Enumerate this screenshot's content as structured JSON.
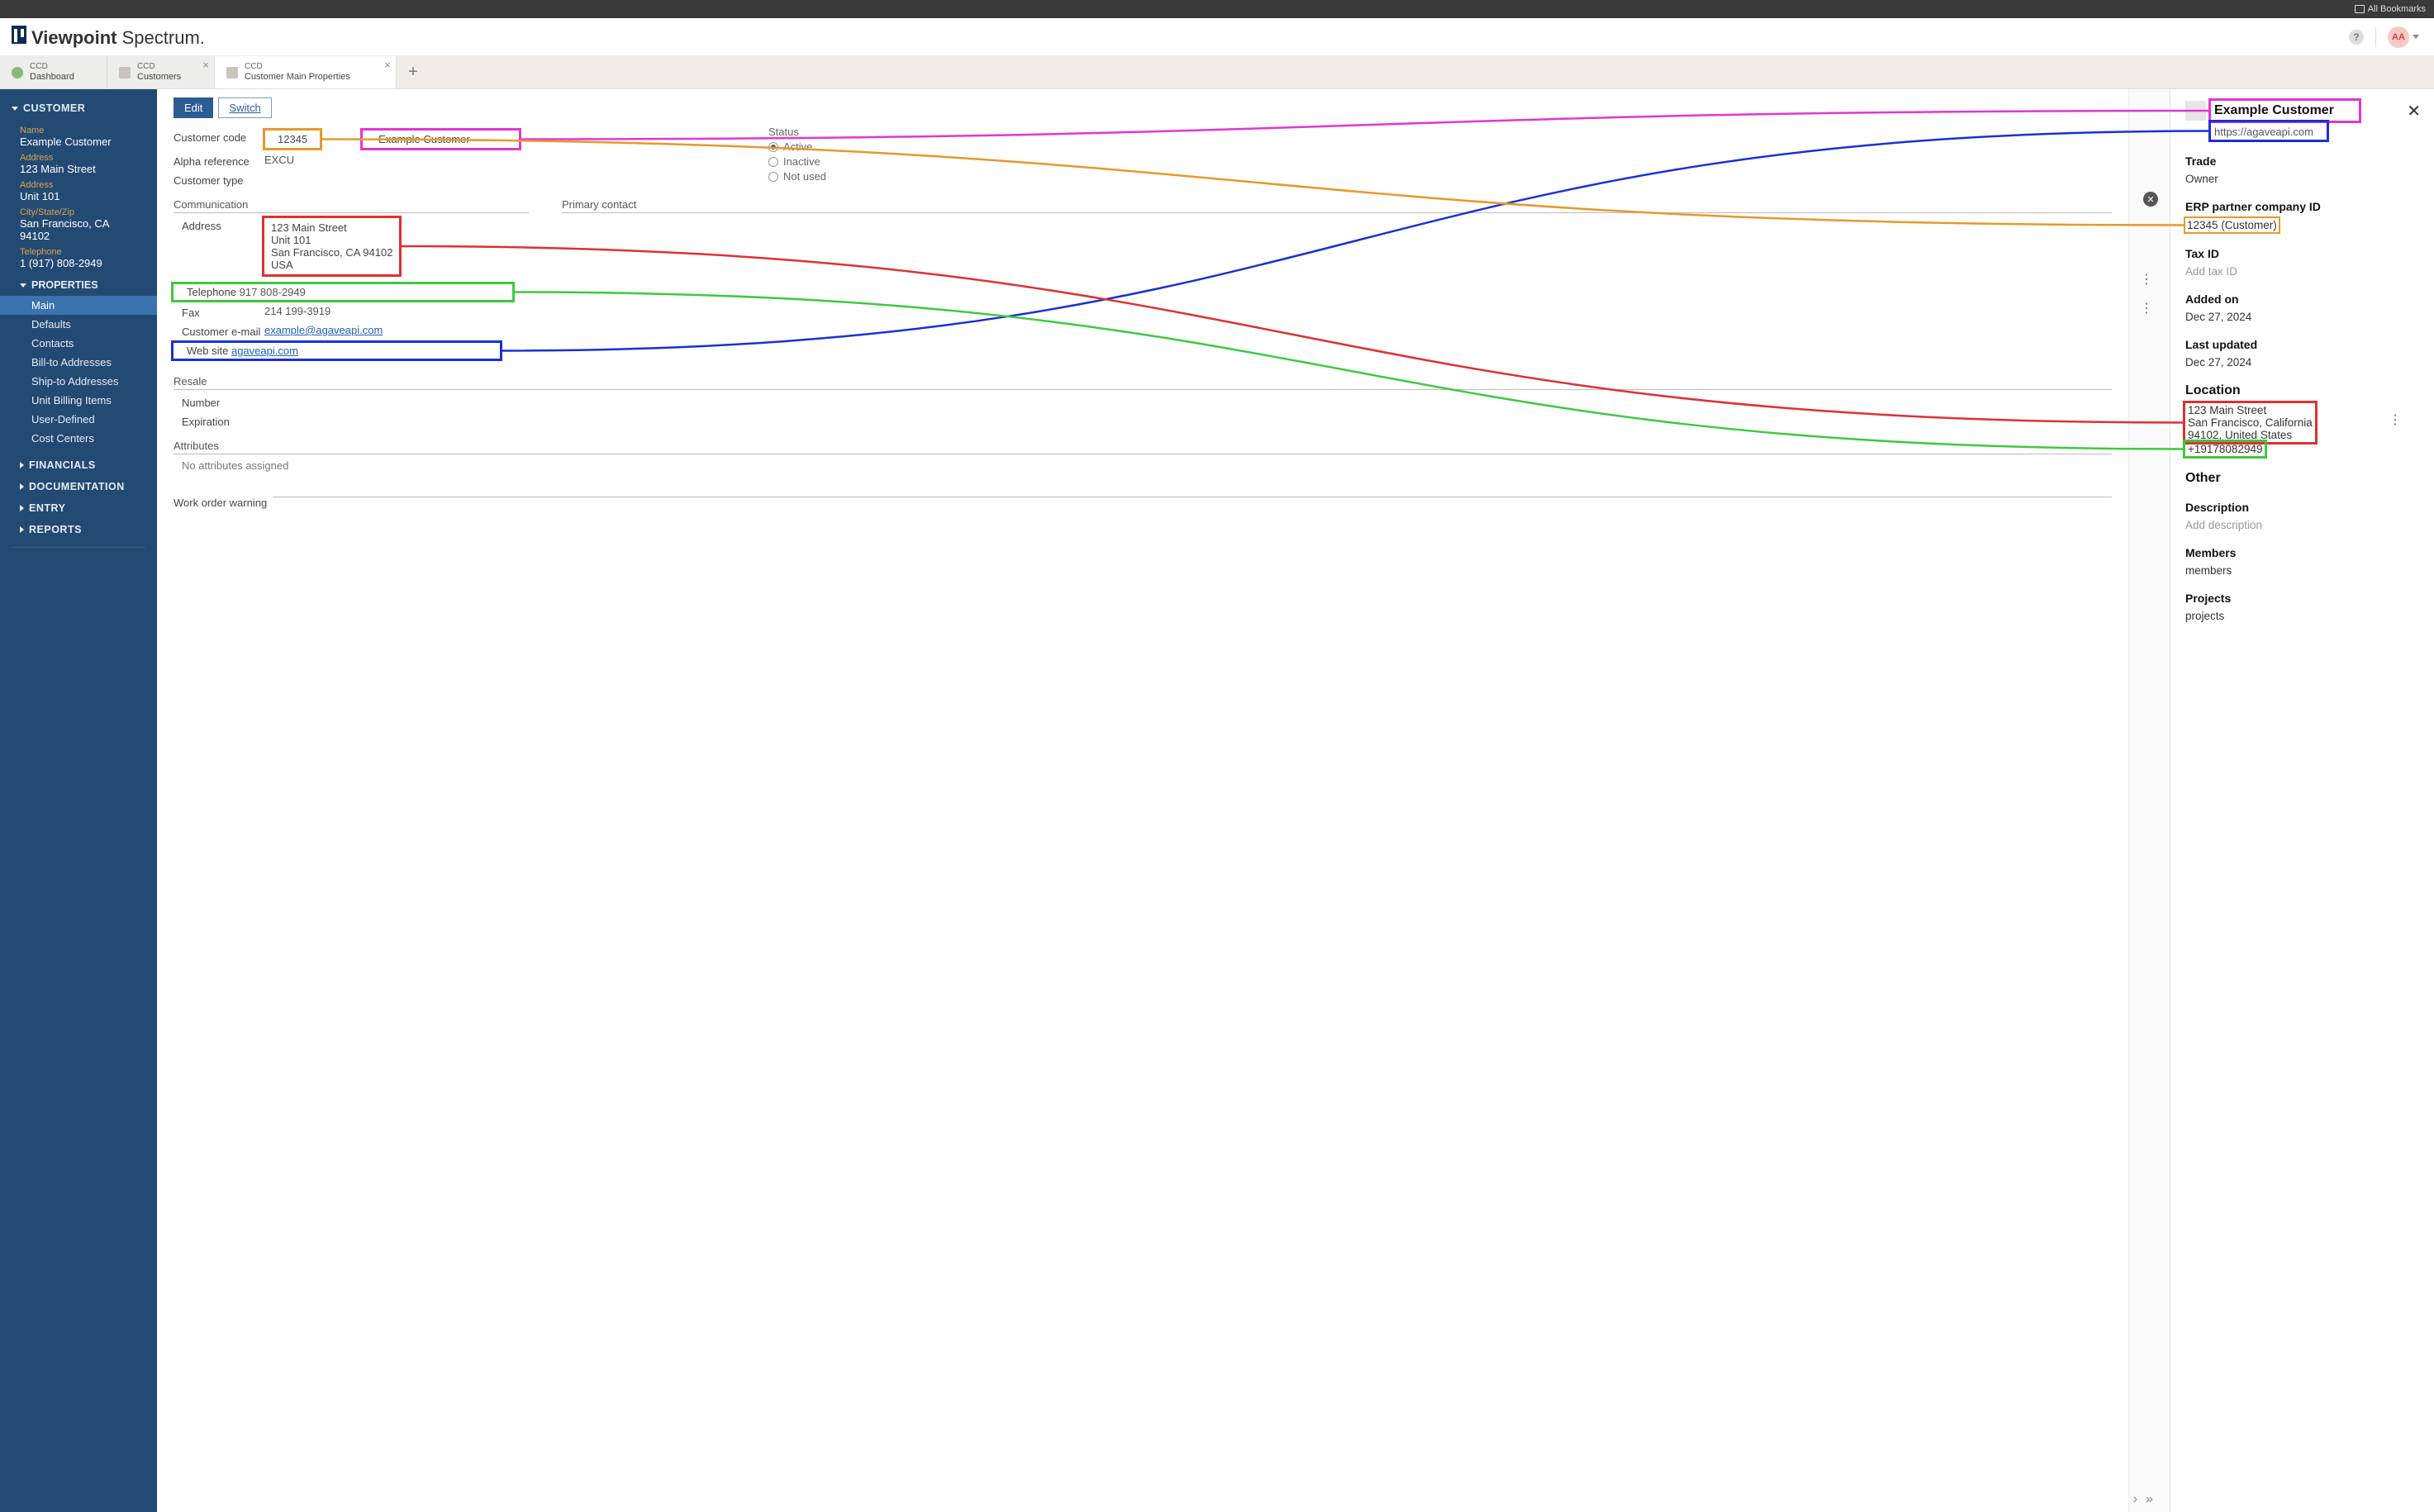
{
  "browser": {
    "bookmarks": "All Bookmarks"
  },
  "brand": {
    "name1": "Viewpoint",
    "name2": "Spectrum."
  },
  "header": {
    "avatar": "AA"
  },
  "tabs": [
    {
      "prefix": "CCD",
      "label": "Dashboard"
    },
    {
      "prefix": "CCD",
      "label": "Customers"
    },
    {
      "prefix": "CCD",
      "label": "Customer Main Properties"
    }
  ],
  "sidebar": {
    "section": "CUSTOMER",
    "name_label": "Name",
    "name": "Example Customer",
    "addr1_label": "Address",
    "addr1": "123 Main Street",
    "addr2_label": "Address",
    "addr2": "Unit 101",
    "csz_label": "City/State/Zip",
    "csz": "San Francisco, CA 94102",
    "tel_label": "Telephone",
    "tel": "1 (917) 808-2949",
    "properties_label": "PROPERTIES",
    "nav": [
      "Main",
      "Defaults",
      "Contacts",
      "Bill-to Addresses",
      "Ship-to Addresses",
      "Unit Billing Items",
      "User-Defined",
      "Cost Centers"
    ],
    "nav2": [
      "FINANCIALS",
      "DOCUMENTATION",
      "ENTRY",
      "REPORTS"
    ]
  },
  "toolbar": {
    "edit": "Edit",
    "switch": "Switch"
  },
  "form": {
    "code_label": "Customer code",
    "code": "12345",
    "name": "Example Customer",
    "alpha_label": "Alpha reference",
    "alpha": "EXCU",
    "type_label": "Customer type",
    "status_label": "Status",
    "status_options": [
      "Active",
      "Inactive",
      "Not used"
    ],
    "comm_label": "Communication",
    "primary_label": "Primary contact",
    "addr_label": "Address",
    "addr_lines": [
      "123 Main Street",
      "Unit 101",
      "San Francisco, CA  94102",
      "USA"
    ],
    "tel_label": "Telephone",
    "tel": "917 808-2949",
    "fax_label": "Fax",
    "fax": "214 199-3919",
    "email_label": "Customer e-mail",
    "email": "example@agaveapi.com",
    "web_label": "Web site",
    "web": "agaveapi.com",
    "resale_label": "Resale",
    "resale_number_label": "Number",
    "resale_exp_label": "Expiration",
    "attr_label": "Attributes",
    "attr_val": "No attributes assigned",
    "wow_label": "Work order warning"
  },
  "rpanel": {
    "title": "Example Customer",
    "url": "https://agaveapi.com",
    "trade_label": "Trade",
    "trade": "Owner",
    "erp_label": "ERP partner company ID",
    "erp": "12345 (Customer)",
    "tax_label": "Tax ID",
    "tax_placeholder": "Add tax ID",
    "added_label": "Added on",
    "added": "Dec 27, 2024",
    "updated_label": "Last updated",
    "updated": "Dec 27, 2024",
    "location_label": "Location",
    "loc1": "123 Main Street",
    "loc2": "San Francisco, California",
    "loc3": "94102, United States",
    "loc_phone": "+19178082949",
    "other_label": "Other",
    "desc_label": "Description",
    "desc_placeholder": "Add description",
    "members_label": "Members",
    "members": "members",
    "projects_label": "Projects",
    "projects": "projects"
  }
}
